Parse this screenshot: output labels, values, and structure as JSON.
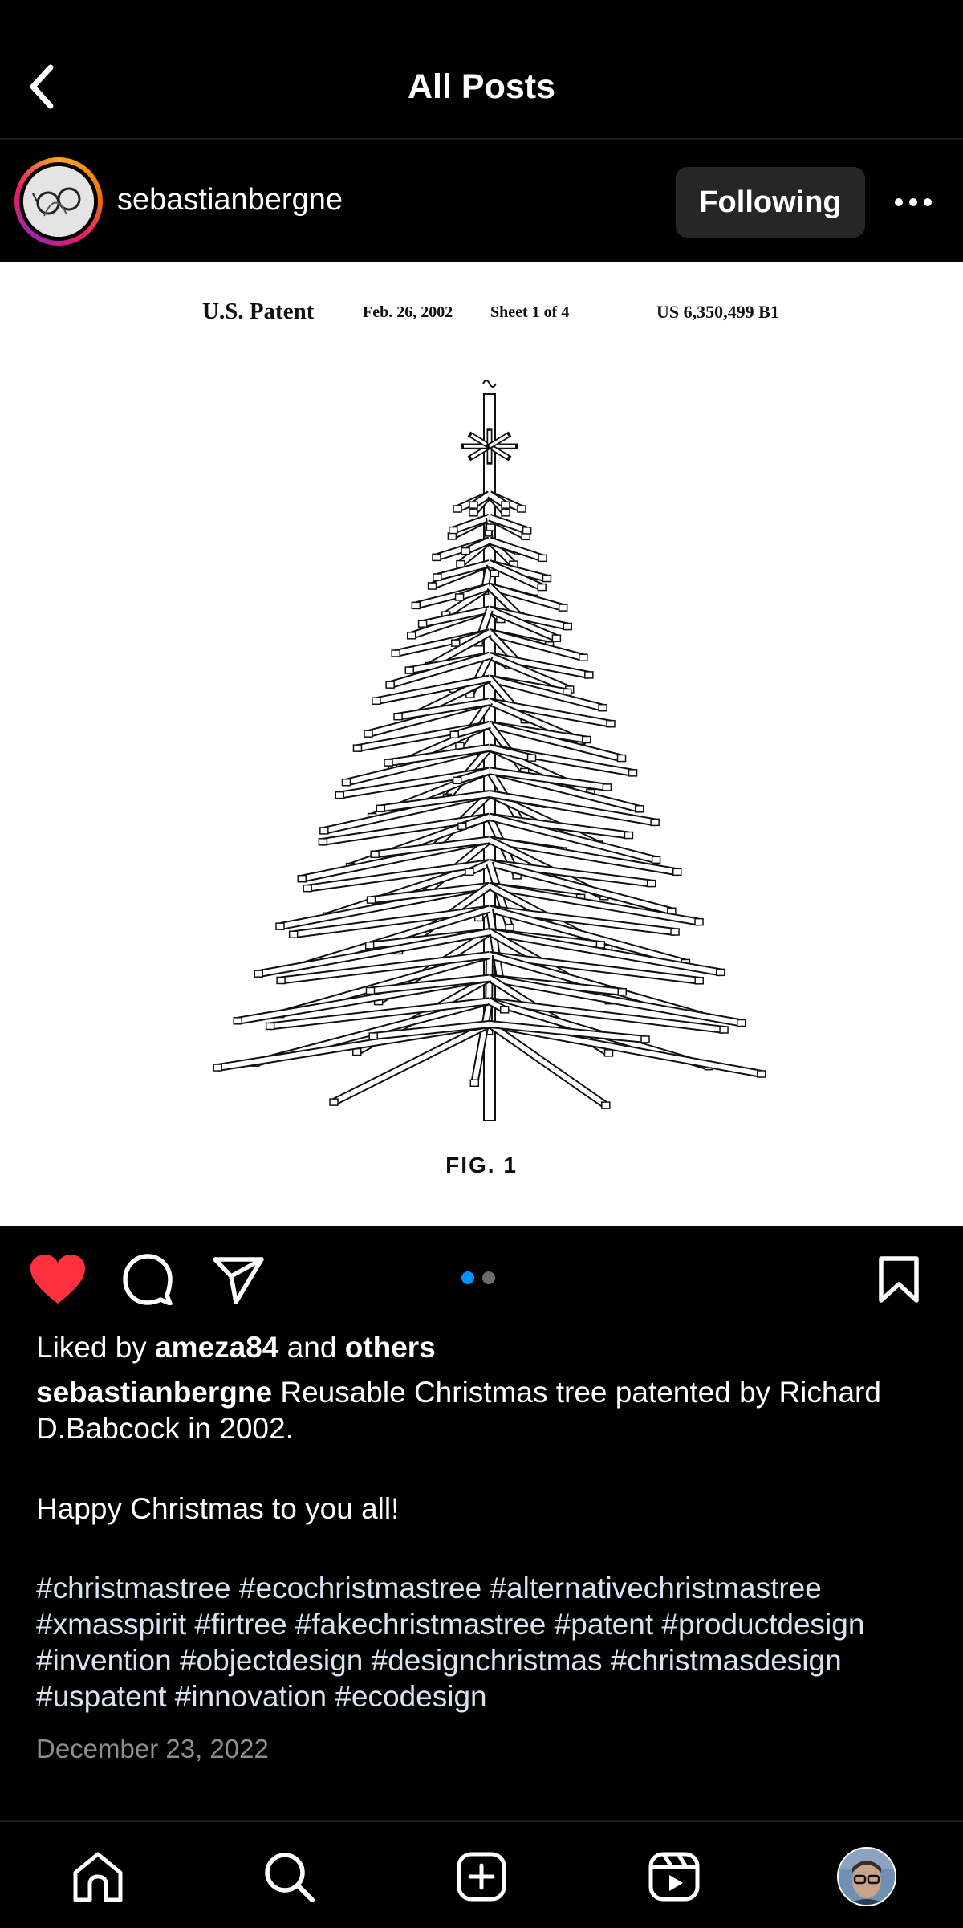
{
  "header": {
    "title": "All Posts"
  },
  "post": {
    "username": "sebastianbergne",
    "follow_label": "Following",
    "image": {
      "patent_title": "U.S. Patent",
      "patent_date": "Feb. 26, 2002",
      "sheet": "Sheet 1 of 4",
      "patent_number": "US 6,350,499 B1",
      "figure_label": "FIG.  1"
    },
    "carousel": {
      "count": 2,
      "active_index": 0
    },
    "liked": true,
    "likes": {
      "prefix": "Liked by",
      "user": "ameza84",
      "joiner": "and",
      "others": "others"
    },
    "caption": {
      "username": "sebastianbergne",
      "text": "Reusable Christmas tree patented by Richard D.Babcock in 2002.",
      "greeting": "Happy Christmas to you all!",
      "hashtags": "#christmastree #ecochristmastree #alternativechristmastree #xmasspirit #firtree #fakechristmastree #patent #productdesign #invention #objectdesign #designchristmas #christmasdesign #uspatent #innovation #ecodesign"
    },
    "date": "December 23, 2022"
  },
  "colors": {
    "like": "#ff3040",
    "accent": "#0095f6",
    "following_bg": "#262626"
  },
  "icons": {
    "back": "chevron-left-icon",
    "more": "more-horizontal-icon",
    "like": "heart-icon",
    "comment": "comment-icon",
    "share": "send-icon",
    "save": "bookmark-icon",
    "nav": [
      "home-icon",
      "search-icon",
      "create-icon",
      "reels-icon",
      "profile-avatar"
    ]
  }
}
